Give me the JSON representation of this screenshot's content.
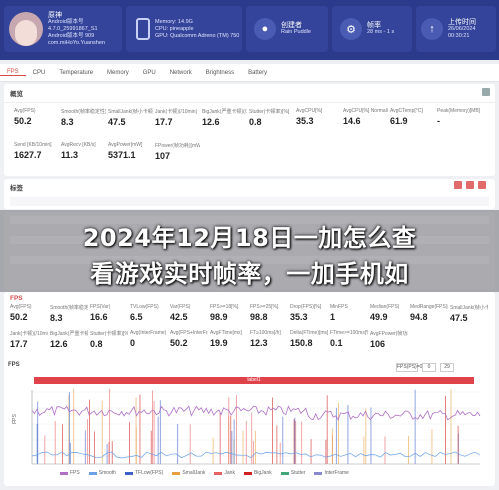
{
  "header": {
    "device_name": "原神",
    "device_line1": "Android版本号 4.7.0_25991867_S1",
    "device_line2": "Android版本号 909",
    "device_line3": "com.miHoYo.Yuanshen",
    "memory_label": "Memory: 14.9G",
    "cpu_label": "CPU: pineapple",
    "gpu_label": "GPU: Qualcomm Adreno (TM) 750",
    "creator_label": "创建者",
    "creator_value": "Rain Puddle",
    "settings_label": "帧率",
    "settings_value": "28 ms - 1 s",
    "upload_label": "上传时间",
    "upload_value": "26/06/2024 00:30:21"
  },
  "tabs": [
    "FPS",
    "CPU",
    "Temperature",
    "Memory",
    "GPU",
    "Network",
    "Brightness",
    "Battery"
  ],
  "overview": {
    "title": "概览",
    "row1": [
      {
        "label": "Avg(FPS)",
        "value": "50.2"
      },
      {
        "label": "Smooth(帧率稳定性)",
        "value": "8.3"
      },
      {
        "label": "SmallJank(帧小卡顿)(/10min)",
        "value": "47.5"
      },
      {
        "label": "Jank(卡顿)(/10min)",
        "value": "17.7"
      },
      {
        "label": "BigJank(严重卡顿)(/10min)",
        "value": "12.6"
      },
      {
        "label": "Stutter(卡顿率)[%]",
        "value": "0.8"
      },
      {
        "label": "AvgCPU[%]",
        "value": "35.3"
      },
      {
        "label": "AvgCPU[%] Normalized",
        "value": "14.6"
      },
      {
        "label": "AvgCTemp[°C]",
        "value": "61.9"
      },
      {
        "label": "Peak(Memory)[MB]",
        "value": "-"
      }
    ],
    "row2": [
      {
        "label": "Send [KB/10min]",
        "value": "1627.7"
      },
      {
        "label": "AvgRecv [KB/s]",
        "value": "11.3"
      },
      {
        "label": "AvgPower[mW]",
        "value": "5371.1"
      },
      {
        "label": "FPower(帧功耗)[mW]",
        "value": "107"
      }
    ]
  },
  "tags_title": "标签",
  "fps_panel": {
    "title": "FPS",
    "row1": [
      {
        "label": "Avg(FPS)",
        "value": "50.2"
      },
      {
        "label": "Smooth(帧率稳定性)",
        "value": "8.3"
      },
      {
        "label": "FPS(Var)",
        "value": "16.6"
      },
      {
        "label": "TVLow(FPS)",
        "value": "6.5"
      },
      {
        "label": "Var(FPS)",
        "value": "42.5"
      },
      {
        "label": "FPS>=18[%]",
        "value": "98.9"
      },
      {
        "label": "FPS>=25[%]",
        "value": "98.8"
      },
      {
        "label": "Drop(FPS)[%]",
        "value": "35.3"
      },
      {
        "label": "MinFPS",
        "value": "1"
      },
      {
        "label": "Median(FPS)",
        "value": "49.9"
      },
      {
        "label": "MedRange(FPS)[%]",
        "value": "94.8"
      },
      {
        "label": "SmallJank(帧小卡顿)(/10min)",
        "value": "47.5"
      }
    ],
    "row2": [
      {
        "label": "Jank(卡顿)(/10min)",
        "value": "17.7"
      },
      {
        "label": "BigJank(严重卡顿)(/10min)",
        "value": "12.6"
      },
      {
        "label": "Stutter(卡顿率)[%]",
        "value": "0.8"
      },
      {
        "label": "Avg(InterFrame)",
        "value": "0"
      },
      {
        "label": "Avg(FPS+InterFrame)",
        "value": "50.2"
      },
      {
        "label": "AvgFTime[ms]",
        "value": "19.9"
      },
      {
        "label": "FT≥100ms[/h]",
        "value": "12.3"
      },
      {
        "label": "Delta(FTime)[ms]",
        "value": "150.8"
      },
      {
        "label": "FTime>=100ms[%]",
        "value": "0.1"
      },
      {
        "label": "AvgFPower(帧功耗)[mW]",
        "value": "106"
      }
    ]
  },
  "chart": {
    "label": "FPS",
    "range_label": "label1",
    "ylabel": "FPS",
    "range_box_1": "FPS(PS)=0",
    "range_box_2": "0",
    "range_box_3": "29",
    "legend": [
      {
        "name": "FPS",
        "color": "#b070c8"
      },
      {
        "name": "Smooth",
        "color": "#6aa0e8"
      },
      {
        "name": "TFLow(FPS)",
        "color": "#3c62c8"
      },
      {
        "name": "SmallJank",
        "color": "#e8a040"
      },
      {
        "name": "Jank",
        "color": "#e86060"
      },
      {
        "name": "BigJank",
        "color": "#d02020"
      },
      {
        "name": "Stutter",
        "color": "#40a878"
      },
      {
        "name": "InterFrame",
        "color": "#8888cc"
      }
    ]
  },
  "overlay_title": {
    "line1": "2024年12月18日一加怎么查",
    "line2": "看游戏实时帧率，一加手机如"
  }
}
